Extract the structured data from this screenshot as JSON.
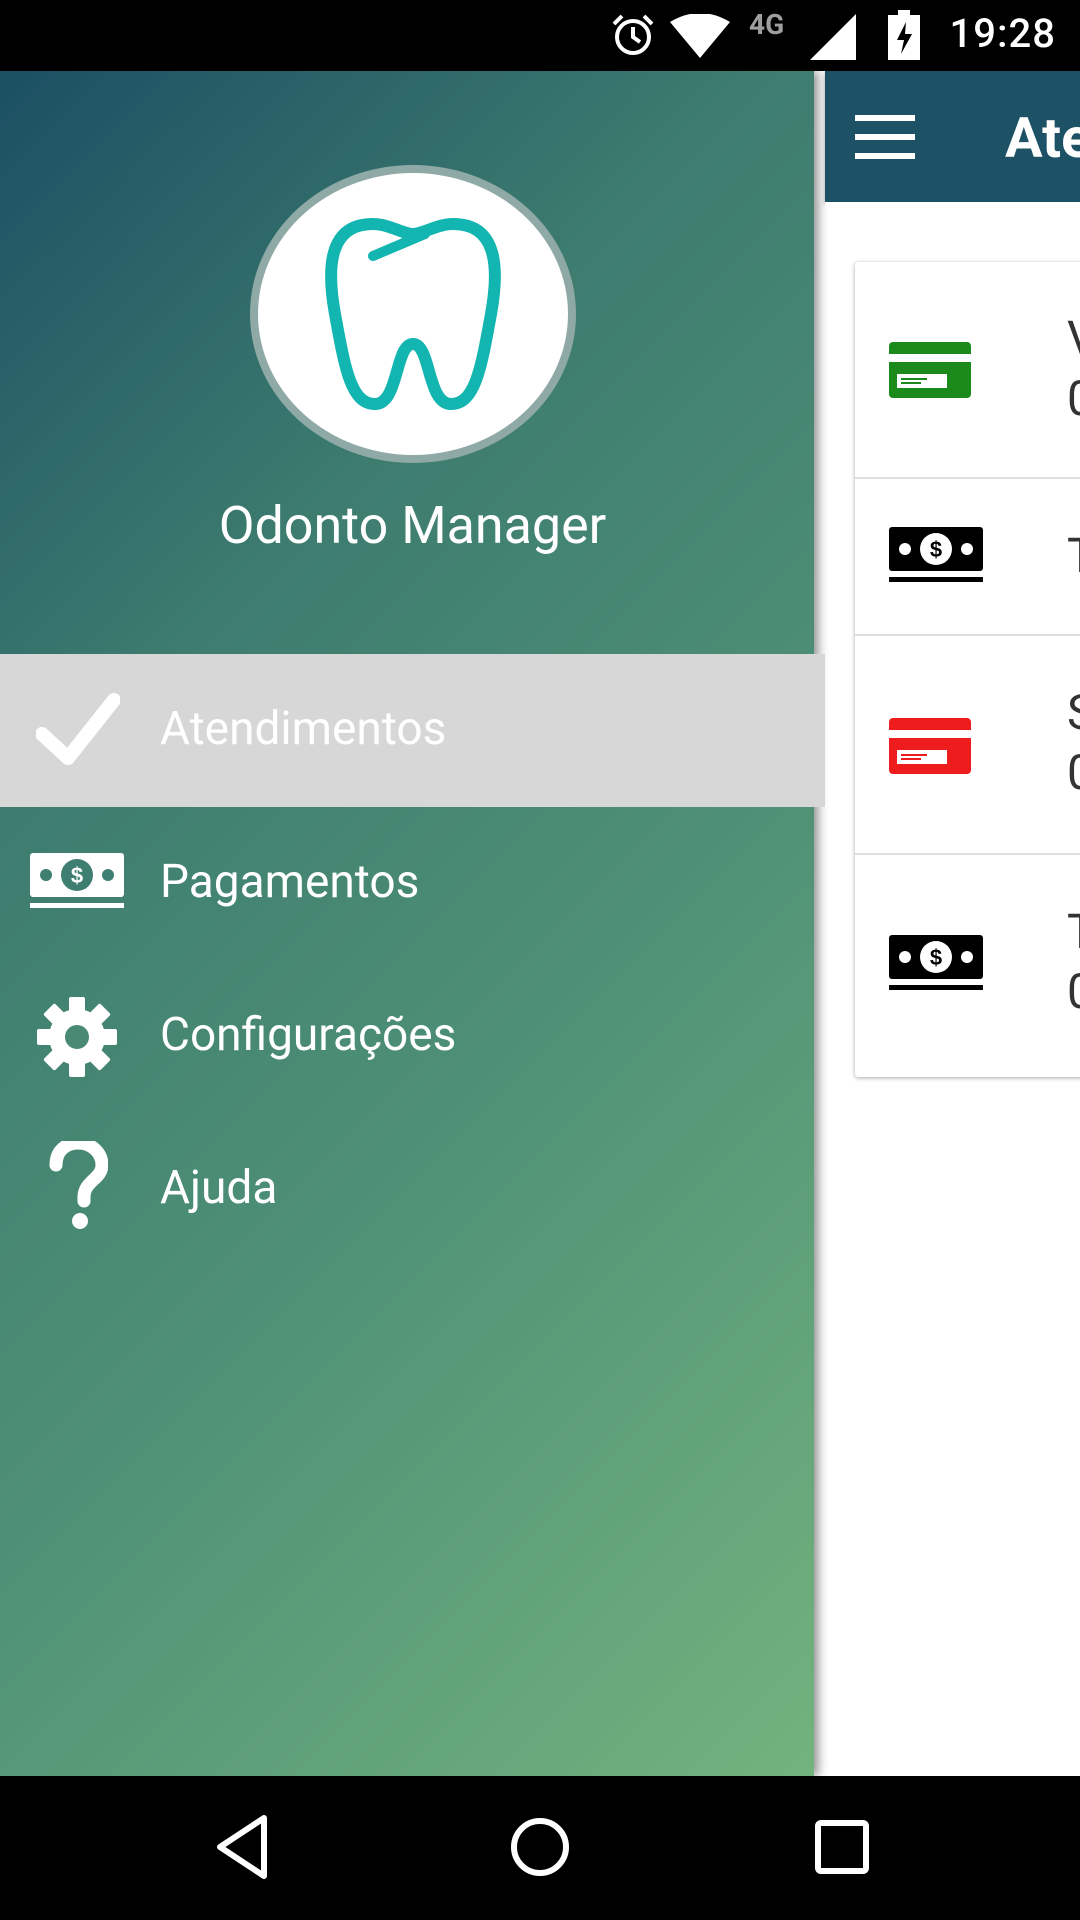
{
  "status_bar": {
    "time": "19:28",
    "network": "4G",
    "icons": [
      "alarm-icon",
      "wifi-icon",
      "signal-icon",
      "battery-charging-icon"
    ]
  },
  "app_bar": {
    "title": "Ate",
    "menu_icon": "hamburger-menu-icon"
  },
  "content": {
    "rows": [
      {
        "icon": "credit-card-icon",
        "color": "#1a8a1a",
        "line1": "V",
        "line2": "0"
      },
      {
        "icon": "money-icon",
        "color": "#000000",
        "line1": "T",
        "line2": ""
      },
      {
        "icon": "credit-card-icon",
        "color": "#ee1c1c",
        "line1": "S",
        "line2": "0"
      },
      {
        "icon": "money-icon",
        "color": "#000000",
        "line1": "T",
        "line2": "0"
      }
    ]
  },
  "drawer": {
    "app_name": "Odonto Manager",
    "logo_icon": "tooth-logo-icon",
    "items": [
      {
        "label": "Atendimentos",
        "icon": "check-icon",
        "active": true
      },
      {
        "label": "Pagamentos",
        "icon": "money-icon",
        "active": false
      },
      {
        "label": "Configurações",
        "icon": "gear-icon",
        "active": false
      },
      {
        "label": "Ajuda",
        "icon": "help-icon",
        "active": false
      }
    ]
  },
  "colors": {
    "app_bar": "#1d5266",
    "logo_teal": "#12b5b0",
    "active_item_bg": "#d7d7d7"
  },
  "nav_bar": {
    "buttons": [
      "back-icon",
      "home-icon",
      "recents-icon"
    ]
  }
}
